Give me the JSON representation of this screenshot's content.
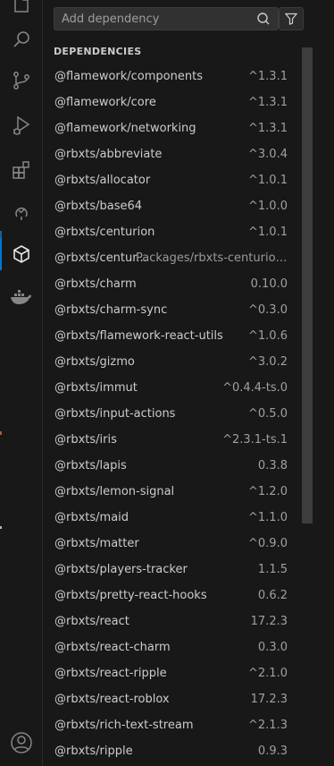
{
  "activity_bar": {
    "icons": [
      "explorer-icon",
      "search-icon",
      "source-control-icon",
      "run-debug-icon",
      "extensions-icon",
      "testing-icon",
      "packages-icon",
      "docker-icon",
      "account-icon"
    ],
    "active": "packages-icon",
    "accent_color": "#0078d4"
  },
  "search": {
    "placeholder": "Add dependency",
    "value": ""
  },
  "section": {
    "title": "DEPENDENCIES"
  },
  "dependencies": [
    {
      "name": "@flamework/components",
      "version": "^1.3.1"
    },
    {
      "name": "@flamework/core",
      "version": "^1.3.1"
    },
    {
      "name": "@flamework/networking",
      "version": "^1.3.1"
    },
    {
      "name": "@rbxts/abbreviate",
      "version": "^3.0.4"
    },
    {
      "name": "@rbxts/allocator",
      "version": "^1.0.1"
    },
    {
      "name": "@rbxts/base64",
      "version": "^1.0.0"
    },
    {
      "name": "@rbxts/centurion",
      "version": "^1.0.1"
    },
    {
      "name": "@rbxts/centur...",
      "path": "Packages/rbxts-centurion-u..."
    },
    {
      "name": "@rbxts/charm",
      "version": "0.10.0"
    },
    {
      "name": "@rbxts/charm-sync",
      "version": "^0.3.0"
    },
    {
      "name": "@rbxts/flamework-react-utils",
      "version": "^1.0.6"
    },
    {
      "name": "@rbxts/gizmo",
      "version": "^3.0.2"
    },
    {
      "name": "@rbxts/immut",
      "version": "^0.4.4-ts.0"
    },
    {
      "name": "@rbxts/input-actions",
      "version": "^0.5.0"
    },
    {
      "name": "@rbxts/iris",
      "version": "^2.3.1-ts.1"
    },
    {
      "name": "@rbxts/lapis",
      "version": "0.3.8"
    },
    {
      "name": "@rbxts/lemon-signal",
      "version": "^1.2.0"
    },
    {
      "name": "@rbxts/maid",
      "version": "^1.1.0"
    },
    {
      "name": "@rbxts/matter",
      "version": "^0.9.0"
    },
    {
      "name": "@rbxts/players-tracker",
      "version": "1.1.5"
    },
    {
      "name": "@rbxts/pretty-react-hooks",
      "version": "0.6.2"
    },
    {
      "name": "@rbxts/react",
      "version": "17.2.3"
    },
    {
      "name": "@rbxts/react-charm",
      "version": "0.3.0"
    },
    {
      "name": "@rbxts/react-ripple",
      "version": "^2.1.0"
    },
    {
      "name": "@rbxts/react-roblox",
      "version": "17.2.3"
    },
    {
      "name": "@rbxts/rich-text-stream",
      "version": "^2.1.3"
    },
    {
      "name": "@rbxts/ripple",
      "version": "0.9.3"
    }
  ]
}
